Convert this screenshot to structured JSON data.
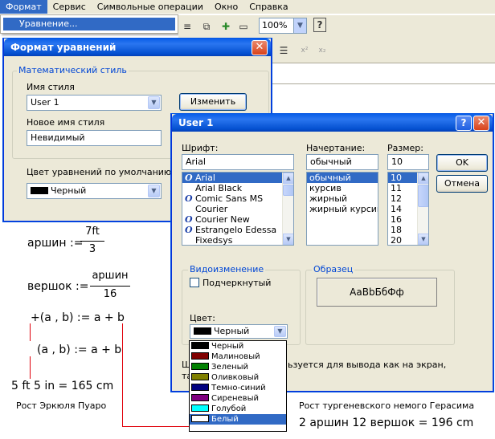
{
  "menubar": {
    "items": [
      "Формат",
      "Сервис",
      "Символьные операции",
      "Окно",
      "Справка"
    ],
    "active_index": 0,
    "dropdown_item": "Уравнение..."
  },
  "toolbar": {
    "zoom": "100%"
  },
  "format_dialog": {
    "title": "Формат уравнений",
    "group_label": "Математический стиль",
    "style_name_label": "Имя стиля",
    "style_name_value": "User 1",
    "change_button": "Изменить",
    "new_style_label": "Новое имя стиля",
    "new_style_value": "Невидимый",
    "default_color_label": "Цвет уравнений по умолчанию",
    "default_color_value": "Черный"
  },
  "user_dialog": {
    "title": "User 1",
    "font_label": "Шрифт:",
    "font_value": "Arial",
    "fonts": [
      "Arial",
      "Arial Black",
      "Comic Sans MS",
      "Courier",
      "Courier New",
      "Estrangelo Edessa",
      "Fixedsys"
    ],
    "font_has_icon": [
      true,
      false,
      true,
      false,
      true,
      true,
      false
    ],
    "style_label": "Начертание:",
    "style_value": "обычный",
    "styles": [
      "обычный",
      "курсив",
      "жирный",
      "жирный курсив"
    ],
    "size_label": "Размер:",
    "size_value": "10",
    "sizes": [
      "10",
      "11",
      "12",
      "14",
      "16",
      "18",
      "20"
    ],
    "ok_button": "OK",
    "cancel_button": "Отмена",
    "effects_label": "Видоизменение",
    "underline_label": "Подчеркнутый",
    "sample_label": "Образец",
    "sample_text": "AaBbБбФф",
    "color_label": "Цвет:",
    "color_value": "Черный",
    "partial_text_1": "Ш",
    "partial_text_2": "ьзуется для вывода как на экран,",
    "partial_text_3": "та",
    "colors": [
      {
        "name": "Черный",
        "hex": "#000000"
      },
      {
        "name": "Малиновый",
        "hex": "#800000"
      },
      {
        "name": "Зеленый",
        "hex": "#008000"
      },
      {
        "name": "Оливковый",
        "hex": "#808000"
      },
      {
        "name": "Темно-синий",
        "hex": "#000080"
      },
      {
        "name": "Сиреневый",
        "hex": "#800080"
      },
      {
        "name": "Голубой",
        "hex": "#00ffff"
      },
      {
        "name": "Белый",
        "hex": "#ffffff"
      }
    ],
    "selected_color_index": 7
  },
  "worksheet": {
    "arshin_lhs": "аршин :=",
    "arshin_num": "7ft",
    "arshin_den": "3",
    "vershok_lhs": "вершок :=",
    "vershok_num": "аршин",
    "vershok_den": "16",
    "def1": "+(a , b) := a + b",
    "def2": "(a , b) := a + b",
    "poirot_expr": "5  ft   5  in = 165 cm",
    "poirot_caption": "Рост Эркюля Пуаро",
    "gerasim_caption": "Рост тургеневского немого Герасима",
    "gerasim_expr": "2  аршин   12  вершок   = 196 cm"
  },
  "colors": {
    "accent": "#316ac5",
    "red_line": "#e0000a",
    "window_bg": "#ece9d8"
  }
}
